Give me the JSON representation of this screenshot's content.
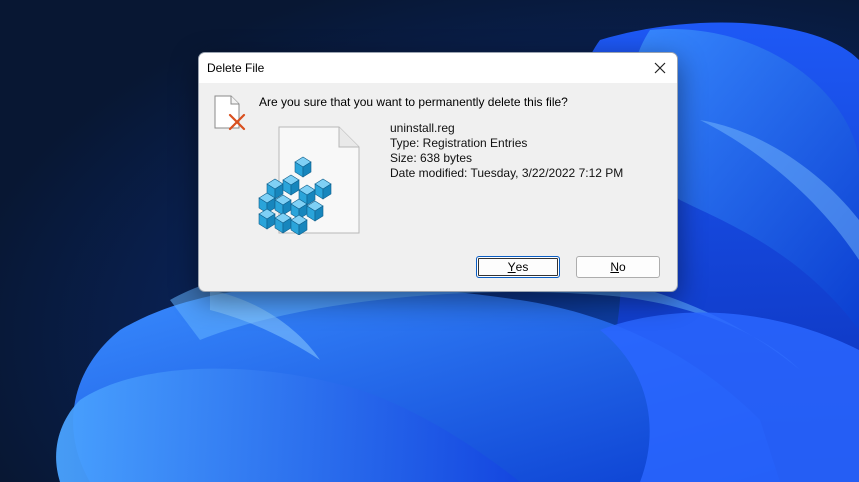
{
  "dialog": {
    "title": "Delete File",
    "question": "Are you sure that you want to permanently delete this file?",
    "file": {
      "name": "uninstall.reg",
      "type": "Type: Registration Entries",
      "size": "Size: 638 bytes",
      "date_modified": "Date modified: Tuesday, 3/22/2022 7:12 PM"
    },
    "buttons": {
      "yes": {
        "mnemonic": "Y",
        "rest": "es"
      },
      "no": {
        "mnemonic": "N",
        "rest": "o"
      }
    },
    "icons": {
      "close": "close-icon",
      "warning": "file-delete-icon",
      "file": "registry-file-icon"
    }
  },
  "colors": {
    "accent": "#0a5dc2",
    "dialog_bg": "#f0f0f0",
    "titlebar_bg": "#ffffff",
    "delete_x": "#d9501f",
    "registry_cube": "#1e8fc8"
  }
}
